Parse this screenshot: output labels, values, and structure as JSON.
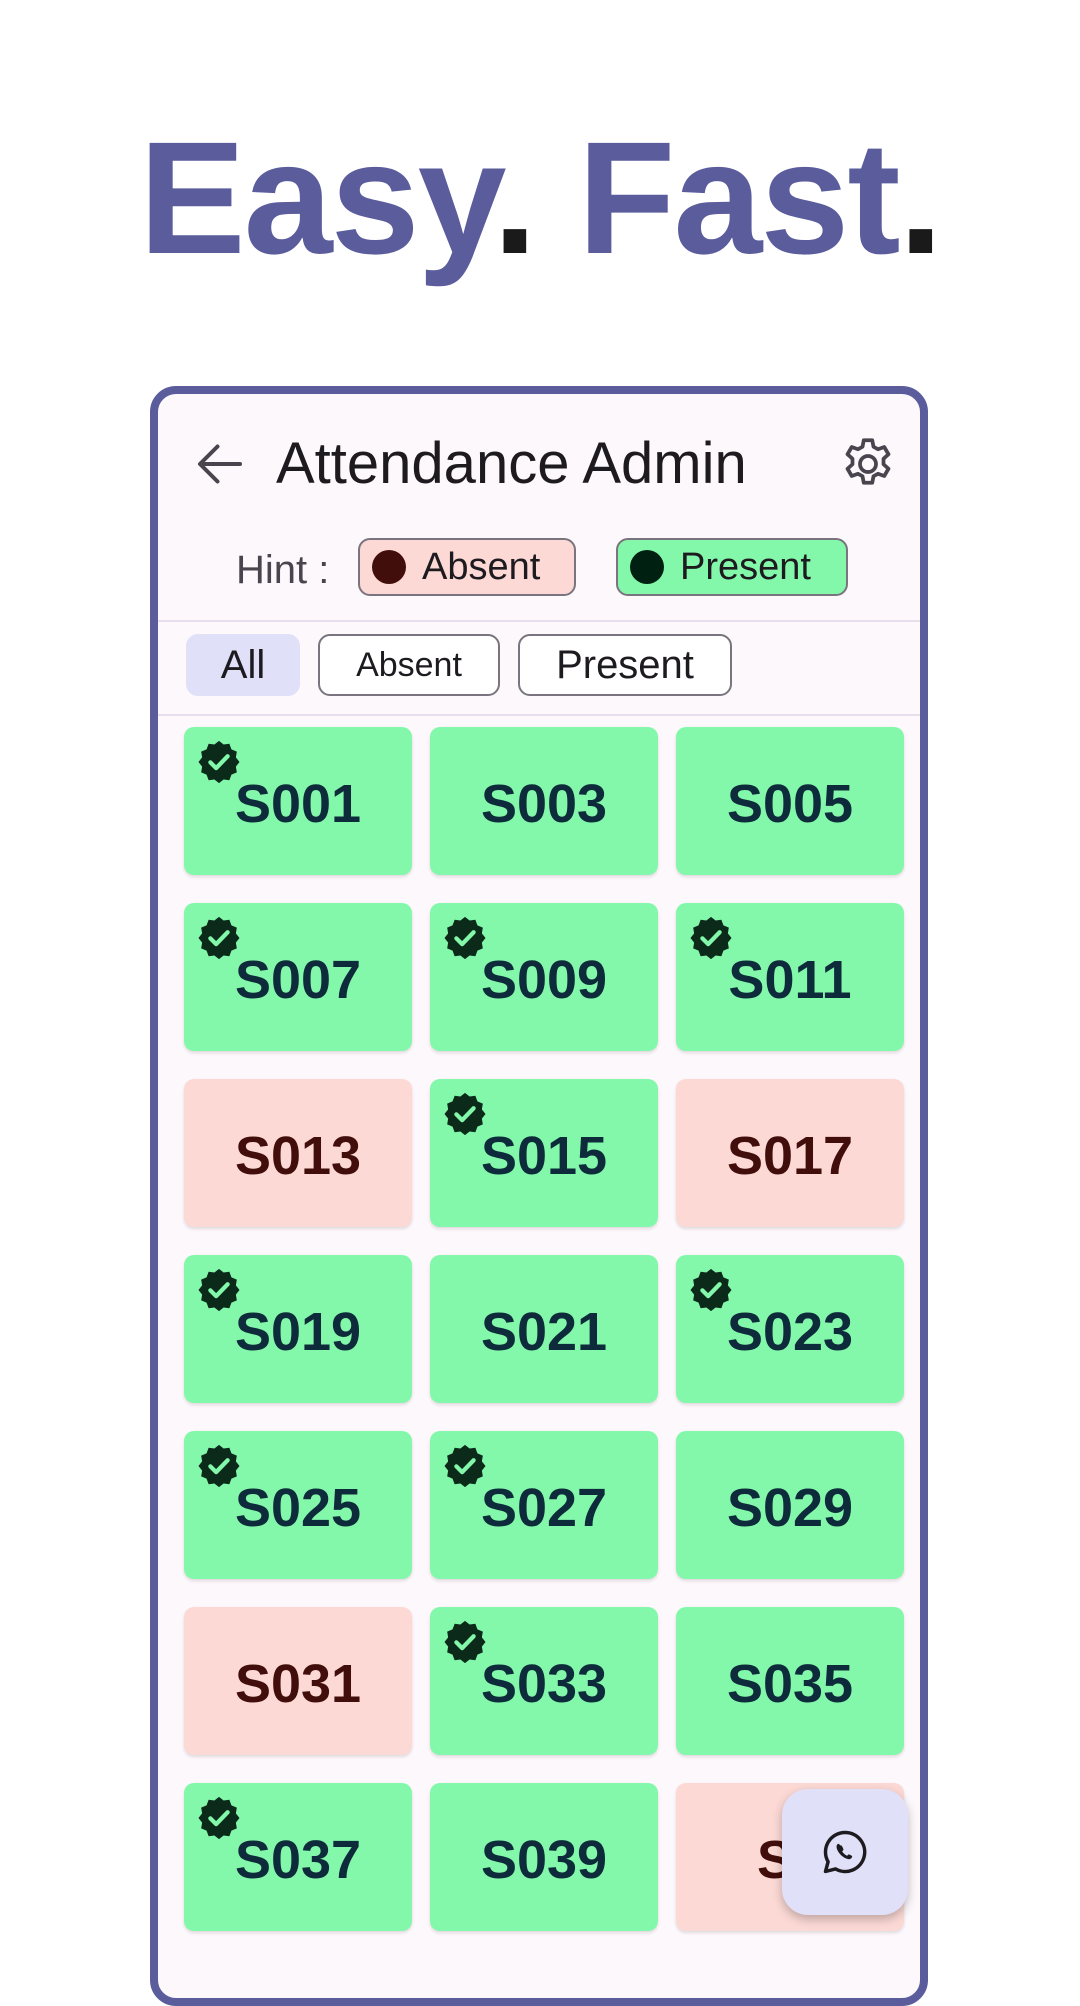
{
  "headline": {
    "word1": "Easy",
    "dot1": ".",
    "word2": "Fast",
    "dot2": "."
  },
  "app_bar": {
    "title": "Attendance Admin",
    "back_icon": "arrow-back-icon",
    "settings_icon": "gear-icon"
  },
  "hint": {
    "label": "Hint :",
    "absent": {
      "label": "Absent",
      "color": "#410e0b",
      "background": "#fcd9d5"
    },
    "present": {
      "label": "Present",
      "color": "#002111",
      "background": "#84f8aa"
    }
  },
  "filters": {
    "all": "All",
    "absent": "Absent",
    "present": "Present",
    "selected": "All"
  },
  "students": [
    {
      "id": "S001",
      "status": "present",
      "checked": true
    },
    {
      "id": "S003",
      "status": "present",
      "checked": false
    },
    {
      "id": "S005",
      "status": "present",
      "checked": false
    },
    {
      "id": "S007",
      "status": "present",
      "checked": true
    },
    {
      "id": "S009",
      "status": "present",
      "checked": true
    },
    {
      "id": "S011",
      "status": "present",
      "checked": true
    },
    {
      "id": "S013",
      "status": "absent",
      "checked": false
    },
    {
      "id": "S015",
      "status": "present",
      "checked": true
    },
    {
      "id": "S017",
      "status": "absent",
      "checked": false
    },
    {
      "id": "S019",
      "status": "present",
      "checked": true
    },
    {
      "id": "S021",
      "status": "present",
      "checked": false
    },
    {
      "id": "S023",
      "status": "present",
      "checked": true
    },
    {
      "id": "S025",
      "status": "present",
      "checked": true
    },
    {
      "id": "S027",
      "status": "present",
      "checked": true
    },
    {
      "id": "S029",
      "status": "present",
      "checked": false
    },
    {
      "id": "S031",
      "status": "absent",
      "checked": false
    },
    {
      "id": "S033",
      "status": "present",
      "checked": true
    },
    {
      "id": "S035",
      "status": "present",
      "checked": false
    },
    {
      "id": "S037",
      "status": "present",
      "checked": true
    },
    {
      "id": "S039",
      "status": "present",
      "checked": false
    },
    {
      "id": "S0",
      "status": "absent",
      "checked": false
    }
  ],
  "fab": {
    "icon": "whatsapp-icon"
  },
  "colors": {
    "brand": "#5a5c9c",
    "present": "#84f8aa",
    "absent": "#fcd9d5"
  }
}
